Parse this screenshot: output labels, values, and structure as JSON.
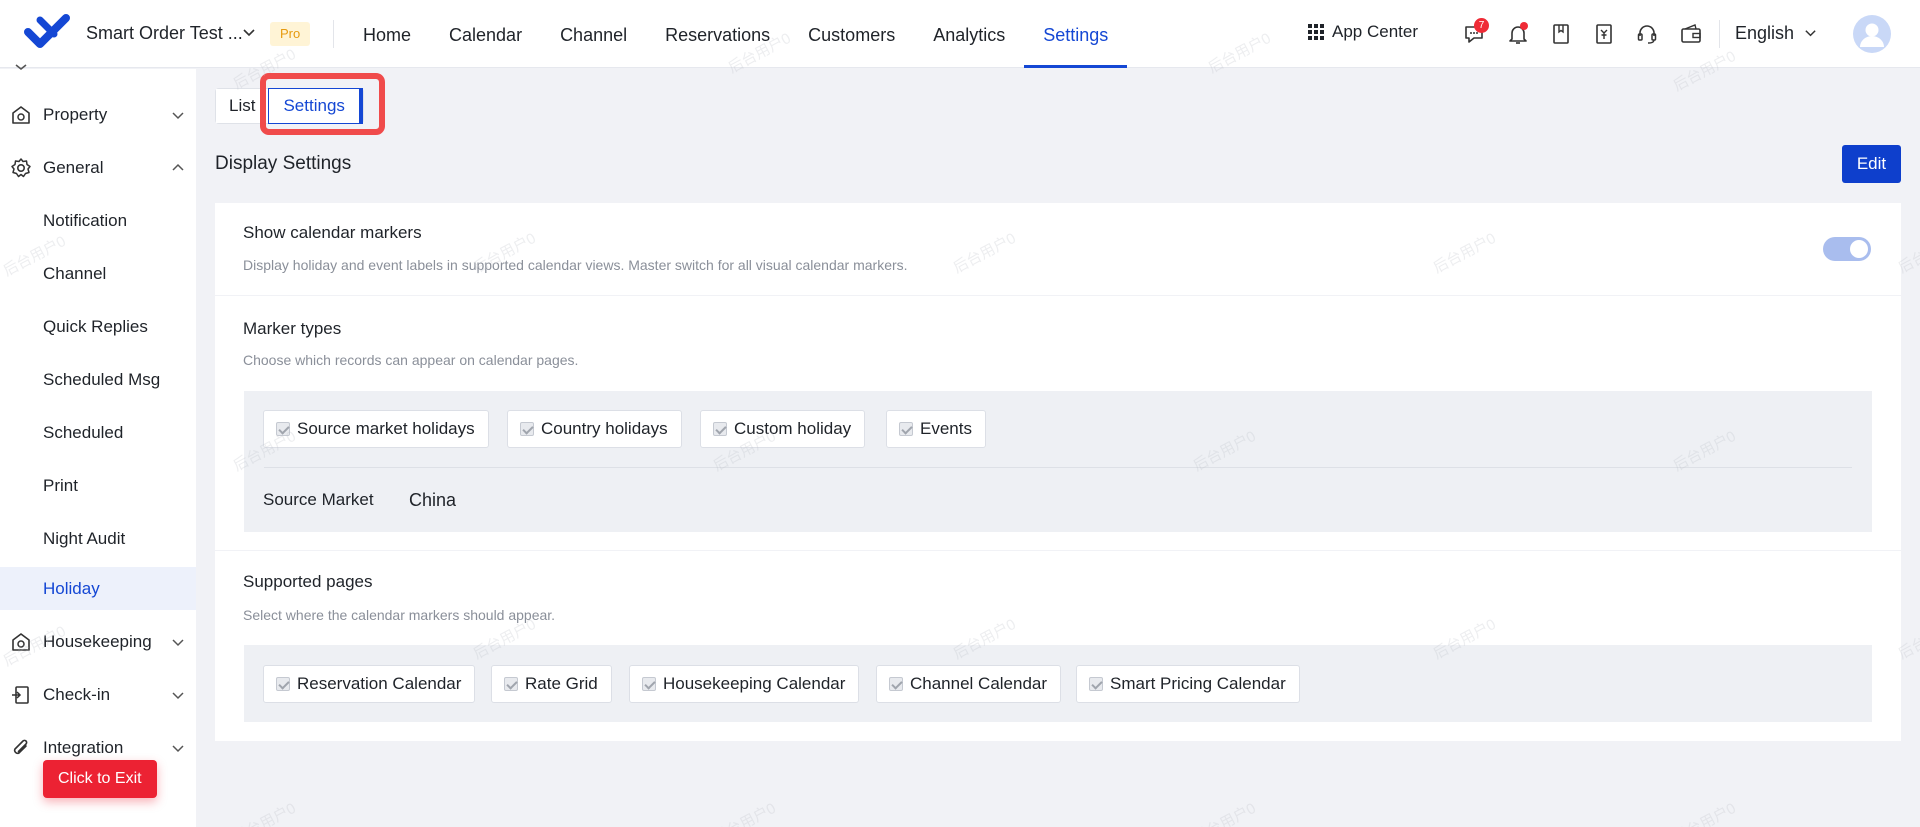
{
  "header": {
    "brand": "Smart Order Test ...",
    "plan_badge": "Pro",
    "nav": [
      "Home",
      "Calendar",
      "Channel",
      "Reservations",
      "Customers",
      "Analytics",
      "Settings"
    ],
    "active_nav": "Settings",
    "app_center": "App Center",
    "message_badge": "7",
    "language": "English"
  },
  "sidebar": {
    "groups": [
      {
        "label": "Property",
        "icon": "property-icon"
      },
      {
        "label": "General",
        "icon": "gear-icon"
      }
    ],
    "general_items": [
      "Notification",
      "Channel",
      "Quick Replies",
      "Scheduled Msg",
      "Scheduled",
      "Print",
      "Night Audit",
      "Holiday"
    ],
    "active_item": "Holiday",
    "lower_groups": [
      {
        "label": "Housekeeping",
        "icon": "housekeeping-icon"
      },
      {
        "label": "Check-in",
        "icon": "check-in-icon"
      },
      {
        "label": "Integration",
        "icon": "paperclip-icon"
      }
    ],
    "exit_button": "Click to Exit"
  },
  "tabs": {
    "list": "List",
    "settings": "Settings"
  },
  "main": {
    "title": "Display Settings",
    "edit_button": "Edit",
    "show_markers": {
      "title": "Show calendar markers",
      "desc": "Display holiday and event labels in supported calendar views. Master switch for all visual calendar markers.",
      "enabled": true
    },
    "marker_types": {
      "title": "Marker types",
      "desc": "Choose which records can appear on calendar pages.",
      "options": [
        "Source market holidays",
        "Country holidays",
        "Custom holiday",
        "Events"
      ],
      "source_market_label": "Source Market",
      "source_market_value": "China"
    },
    "supported_pages": {
      "title": "Supported pages",
      "desc": "Select where the calendar markers should appear.",
      "options": [
        "Reservation Calendar",
        "Rate Grid",
        "Housekeeping Calendar",
        "Channel Calendar",
        "Smart Pricing Calendar"
      ]
    }
  },
  "watermark": "后台用户0",
  "colors": {
    "primary": "#1447d4",
    "edit_button": "#0e3fcc",
    "exit_button": "#ec2233",
    "highlight": "#f04b4b",
    "toggle_on": "#a9bdee",
    "pro_badge_text": "#e69a10"
  }
}
